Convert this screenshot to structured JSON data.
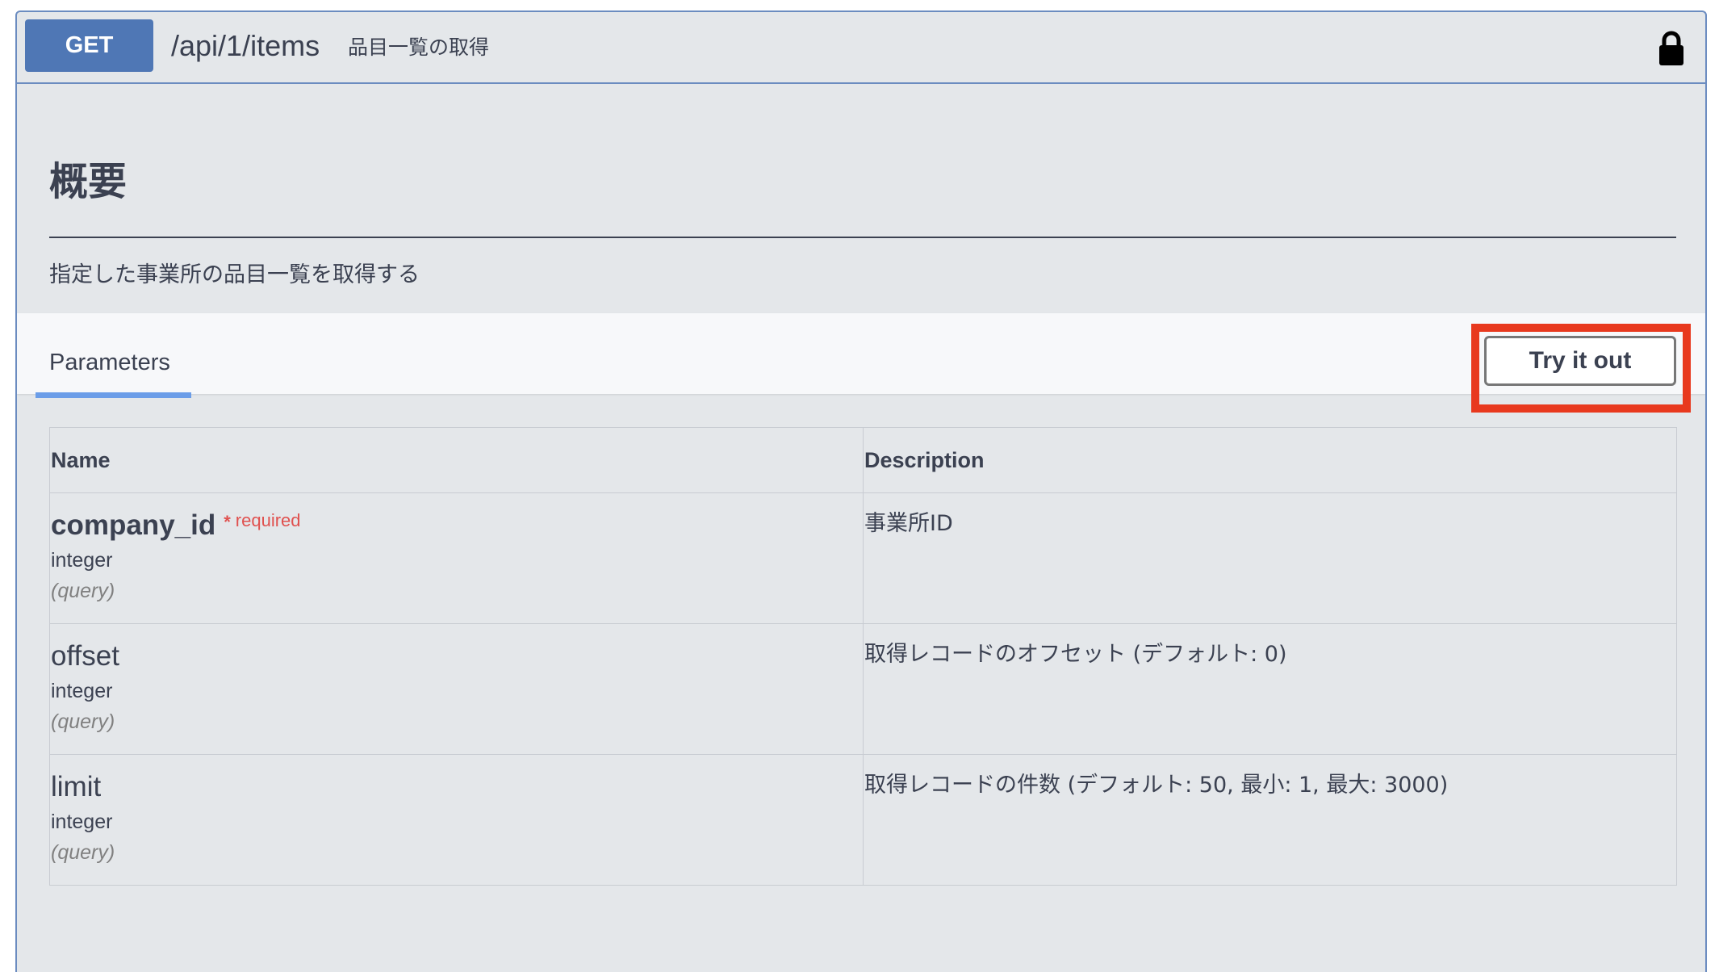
{
  "operation": {
    "method": "GET",
    "path": "/api/1/items",
    "summary": "品目一覧の取得"
  },
  "section": {
    "title": "概要",
    "description": "指定した事業所の品目一覧を取得する"
  },
  "parameters_section": {
    "tab_label": "Parameters",
    "try_button_label": "Try it out",
    "highlight_color": "#e8391e"
  },
  "table": {
    "headers": [
      "Name",
      "Description"
    ],
    "rows": [
      {
        "name": "company_id",
        "required_star": "*",
        "required_label": "required",
        "type": "integer",
        "in": "(query)",
        "description": "事業所ID"
      },
      {
        "name": "offset",
        "type": "integer",
        "in": "(query)",
        "description": "取得レコードのオフセット (デフォルト: 0)"
      },
      {
        "name": "limit",
        "type": "integer",
        "in": "(query)",
        "description": "取得レコードの件数 (デフォルト: 50, 最小: 1, 最大: 3000)"
      }
    ]
  },
  "colors": {
    "get_method": "#4f77b5",
    "border": "#6b8cc0",
    "tab_underline": "#6b9de8",
    "required": "#e0514f"
  },
  "icons": {
    "lock": "lock-icon"
  }
}
